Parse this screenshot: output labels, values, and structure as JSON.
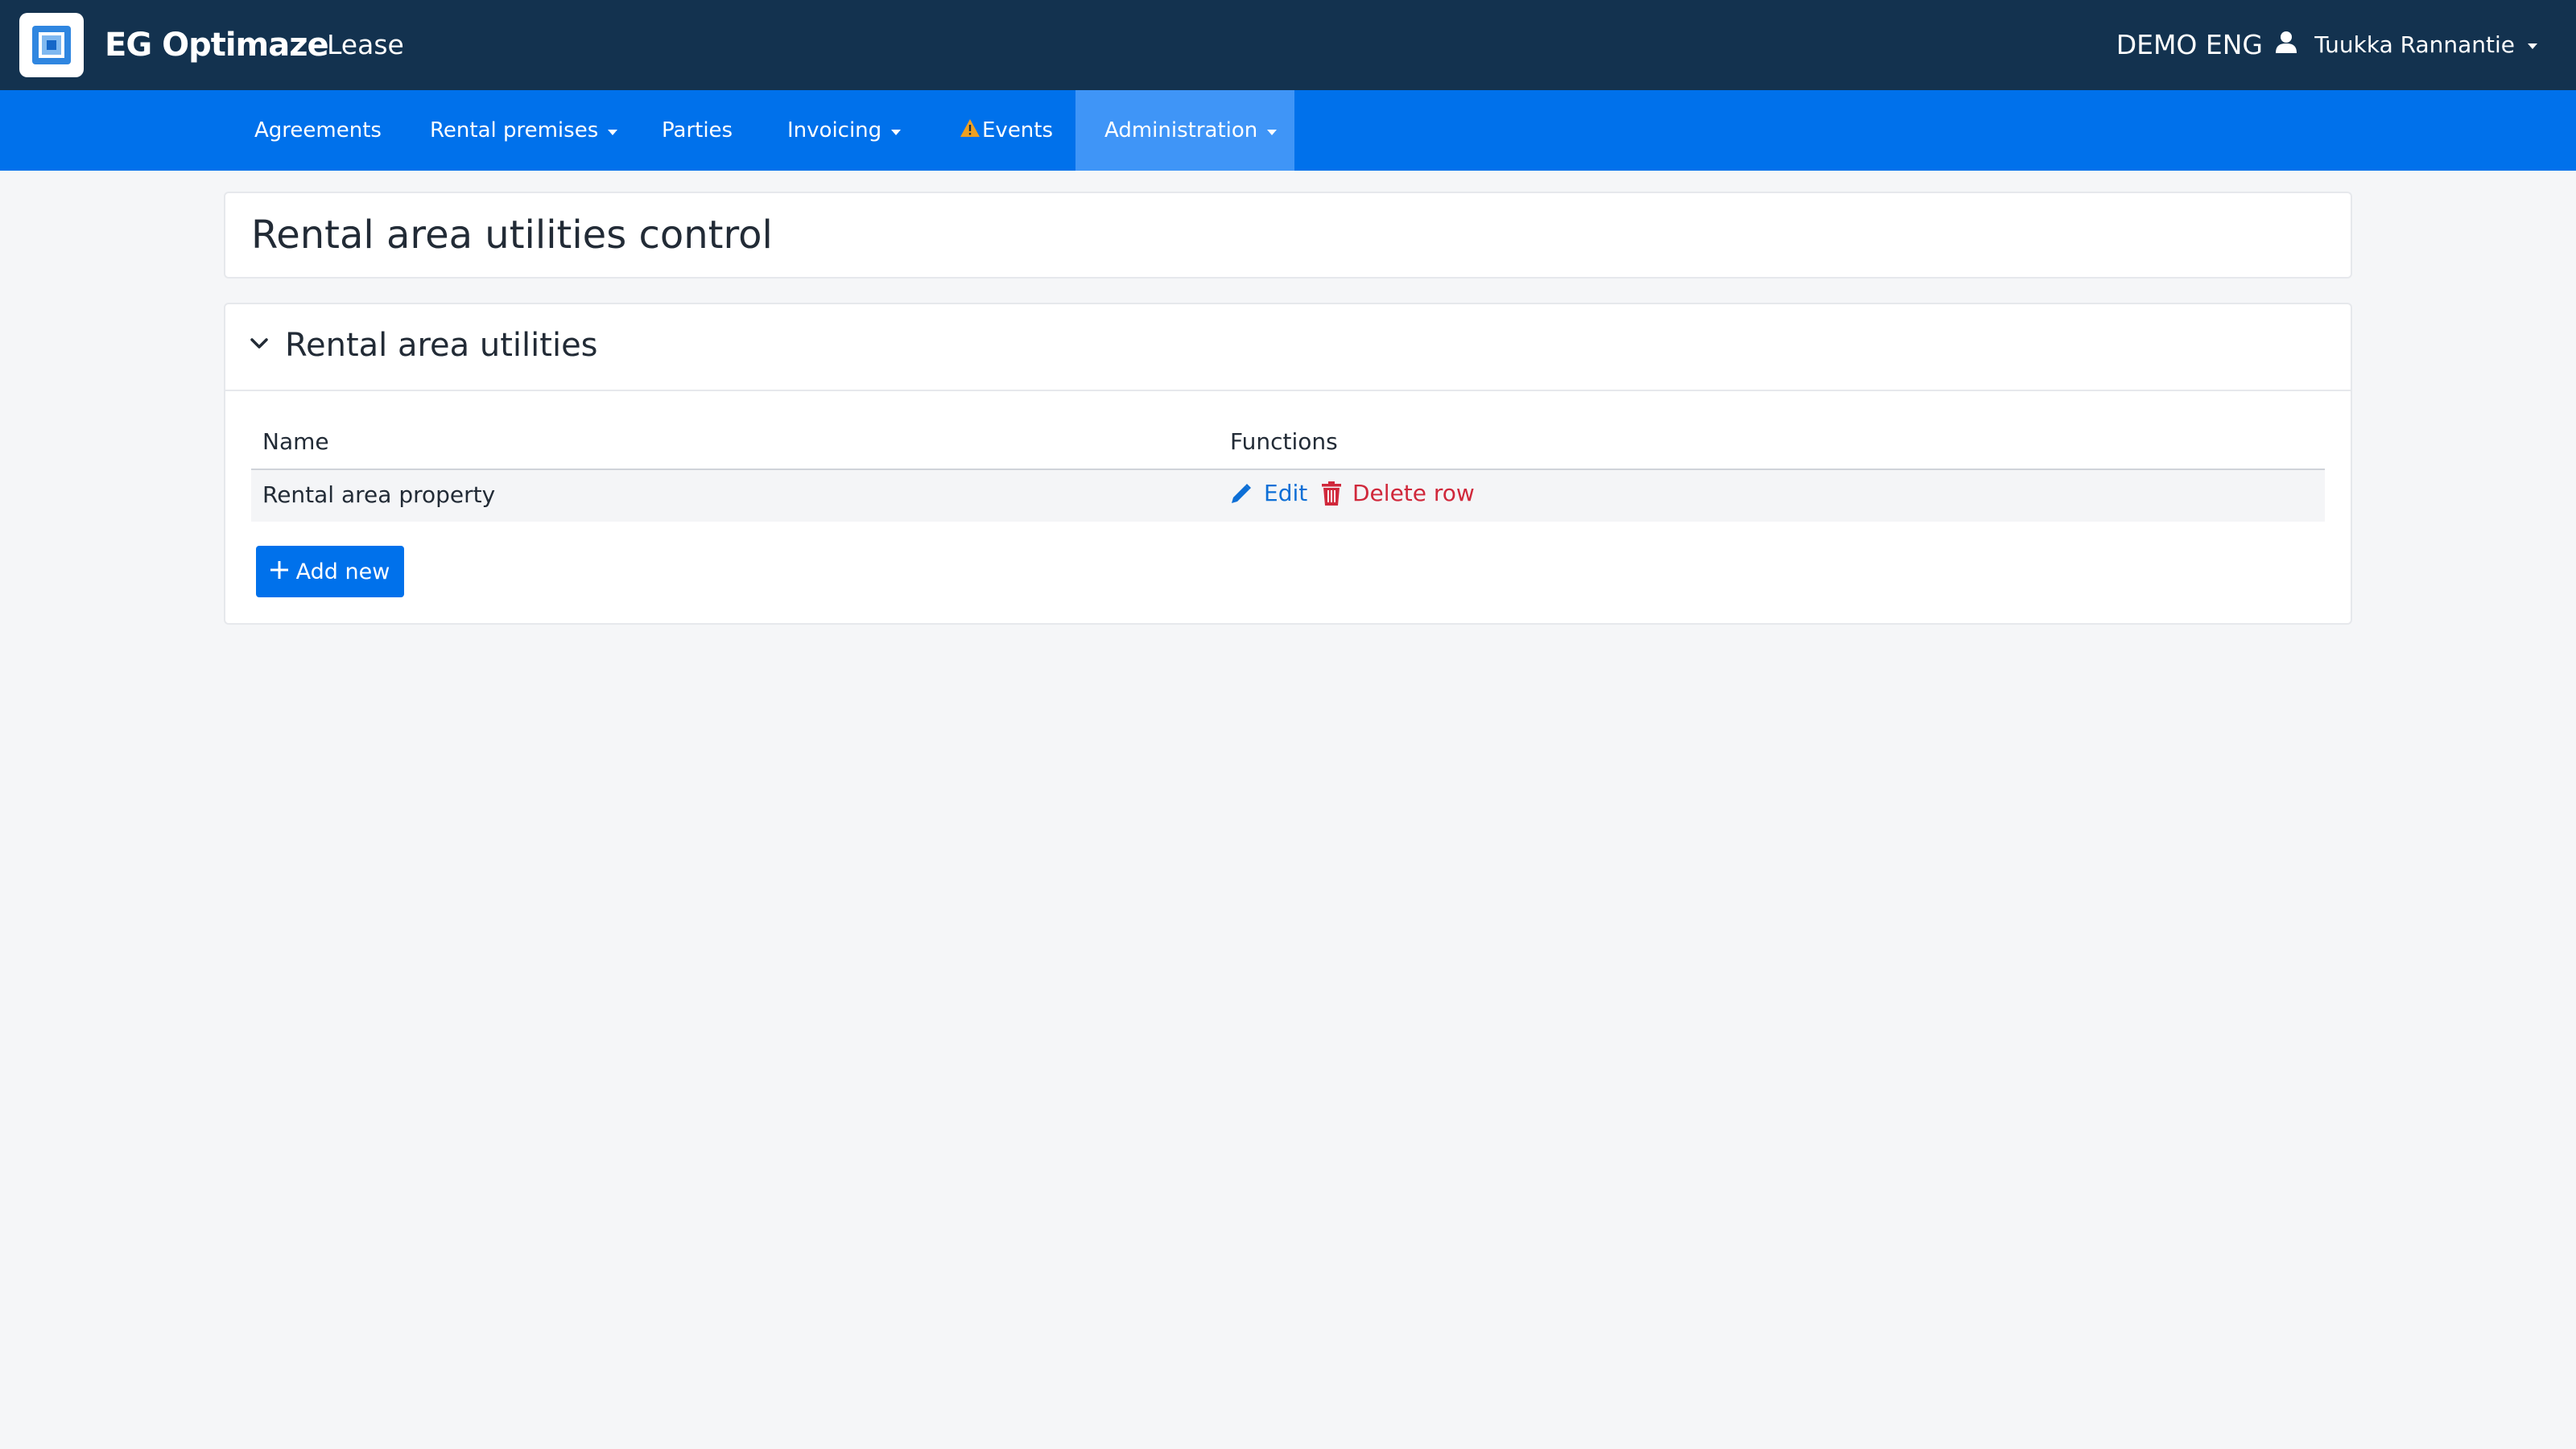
{
  "header": {
    "brand": "EG Optimaze",
    "module": "Lease",
    "environment": "DEMO ENG",
    "user_name": "Tuukka Rannantie"
  },
  "nav": {
    "items": [
      {
        "label": "Agreements",
        "dropdown": false
      },
      {
        "label": "Rental premises",
        "dropdown": true
      },
      {
        "label": "Parties",
        "dropdown": false
      },
      {
        "label": "Invoicing",
        "dropdown": true
      },
      {
        "label": "Events",
        "dropdown": false,
        "icon": "warning-icon"
      },
      {
        "label": "Administration",
        "dropdown": true,
        "active": true
      }
    ]
  },
  "page": {
    "title": "Rental area utilities control"
  },
  "section": {
    "title": "Rental area utilities",
    "expanded": true,
    "table": {
      "columns": [
        "Name",
        "Functions"
      ],
      "rows": [
        {
          "name": "Rental area property",
          "edit_label": "Edit",
          "delete_label": "Delete row"
        }
      ]
    },
    "add_label": "Add new"
  },
  "colors": {
    "header_bg": "#13324f",
    "nav_bg": "#0071eb",
    "nav_active_bg": "#3f95f7",
    "link_blue": "#0d6fd6",
    "danger_red": "#d0283b",
    "warning_orange": "#f0a020",
    "page_bg": "#f5f6f8"
  }
}
